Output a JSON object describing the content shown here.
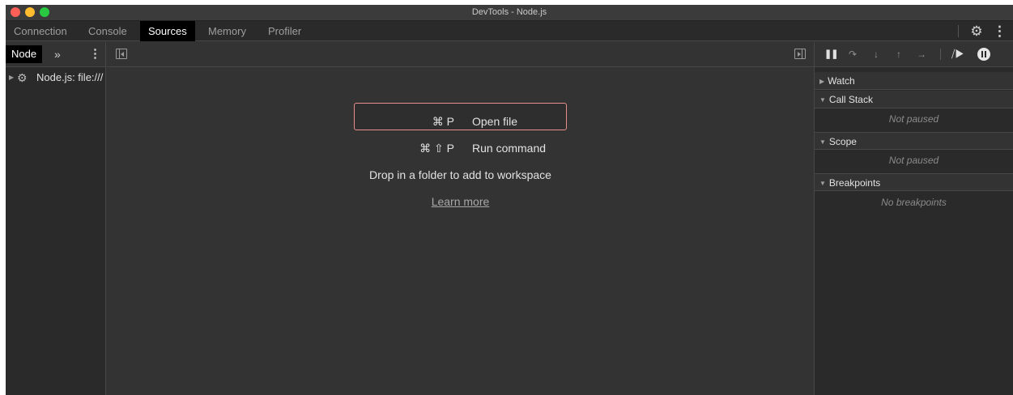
{
  "window": {
    "title": "DevTools - Node.js"
  },
  "tabs": [
    {
      "label": "Connection"
    },
    {
      "label": "Console"
    },
    {
      "label": "Sources"
    },
    {
      "label": "Memory"
    },
    {
      "label": "Profiler"
    }
  ],
  "active_tab": "Sources",
  "navigator": {
    "tab_label": "Node",
    "more_label": "»",
    "kebab_label": "⋮",
    "tree": [
      {
        "label": "Node.js: file:///"
      }
    ]
  },
  "editor": {
    "shortcuts": [
      {
        "key": "⌘ P",
        "label": "Open file"
      },
      {
        "key": "⌘ ⇧ P",
        "label": "Run command"
      }
    ],
    "drop_text": "Drop in a folder to add to workspace",
    "learn_more": "Learn more"
  },
  "debugger": {
    "sections": [
      {
        "title": "Watch",
        "expanded": false,
        "body": ""
      },
      {
        "title": "Call Stack",
        "expanded": true,
        "body": "Not paused"
      },
      {
        "title": "Scope",
        "expanded": true,
        "body": "Not paused"
      },
      {
        "title": "Breakpoints",
        "expanded": true,
        "body": "No breakpoints"
      }
    ]
  },
  "icons": {
    "gear": "gear-icon",
    "kebab": "kebab-menu-icon",
    "pause": "pause-icon",
    "step_over": "step-over-icon",
    "step_into": "step-into-icon",
    "step_out": "step-out-icon",
    "step": "step-icon",
    "deactivate_breakpoints": "deactivate-breakpoints-icon",
    "pause_on_exceptions": "pause-on-exceptions-icon"
  },
  "colors": {
    "active_tab_bg": "#000000",
    "highlight_border": "#e98c8c",
    "panel_bg": "#333333"
  }
}
